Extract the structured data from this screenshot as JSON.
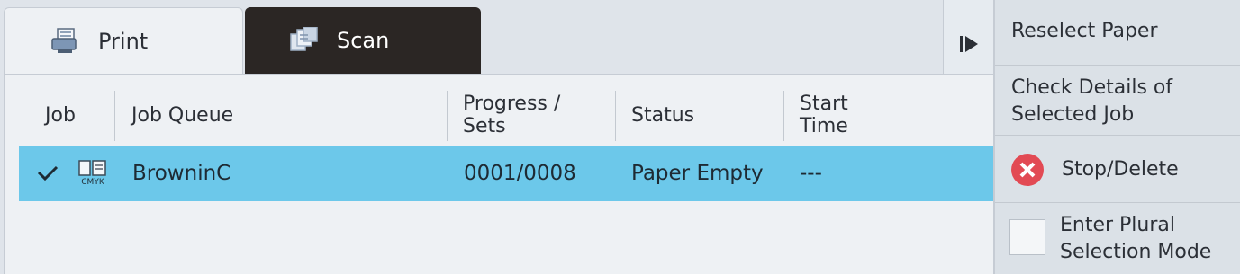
{
  "tabs": [
    {
      "label": "Print",
      "icon": "print-monitor-icon",
      "active": true
    },
    {
      "label": "Scan",
      "icon": "scan-docs-icon",
      "active": false
    }
  ],
  "table": {
    "headers": {
      "job": "Job",
      "job_queue": "Job Queue",
      "progress_line1": "Progress /",
      "progress_line2": "Sets",
      "status": "Status",
      "start_line1": "Start",
      "start_line2": "Time"
    },
    "rows": [
      {
        "selected": true,
        "icon": "print-job-cmyk-icon",
        "icon_text": "CMYK",
        "job_queue": "BrowninC",
        "progress": "0001/0008",
        "status": "Paper Empty",
        "start_time": "---"
      }
    ]
  },
  "side_panel": {
    "reselect_paper": "Reselect Paper",
    "check_details_line1": "Check Details of",
    "check_details_line2": "Selected Job",
    "stop_delete": "Stop/Delete",
    "plural_line1": "Enter Plural",
    "plural_line2": "Selection Mode"
  },
  "colors": {
    "selected_row": "#6cc8ea",
    "stop_icon": "#e24a54",
    "scan_tab": "#2b2624"
  }
}
